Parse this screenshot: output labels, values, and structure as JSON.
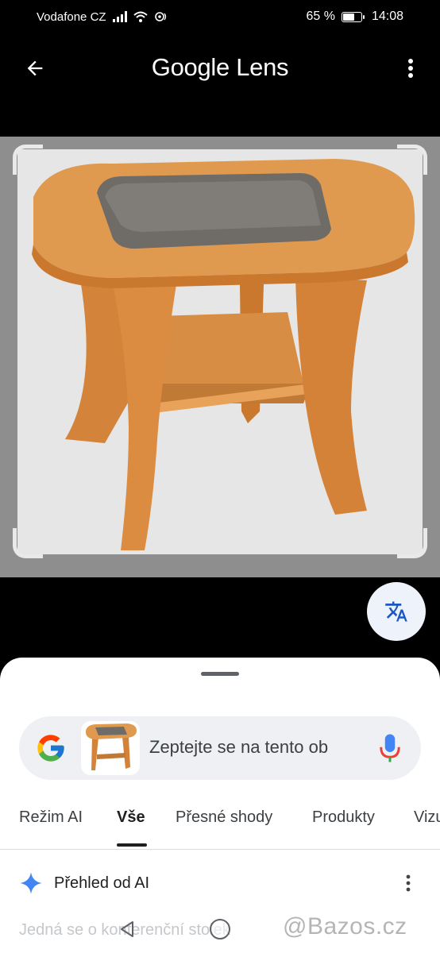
{
  "status_bar": {
    "carrier": "Vodafone CZ",
    "battery_percent": "65 %",
    "battery_level": 0.65,
    "time": "14:08"
  },
  "app_bar": {
    "title": "Google Lens",
    "back_icon": "arrow-back-icon",
    "menu_icon": "more-vert-icon"
  },
  "image": {
    "subject": "wooden coffee table with glass top",
    "translate_icon": "translate-icon"
  },
  "search": {
    "placeholder": "Zeptejte se na tento ob",
    "logo": "google-g-logo",
    "mic_icon": "mic-icon"
  },
  "tabs": [
    {
      "label": "Režim AI",
      "active": false
    },
    {
      "label": "Vše",
      "active": true
    },
    {
      "label": "Přesné shody",
      "active": false
    },
    {
      "label": "Produkty",
      "active": false
    },
    {
      "label": "Vizu",
      "active": false
    }
  ],
  "ai_overview": {
    "title": "Přehled od AI",
    "text": "Jedná se o konferenční stolek"
  },
  "watermark": "@Bazos.cz",
  "colors": {
    "accent_blue": "#4285F4",
    "sheet_bg": "#FFFFFF",
    "search_bg": "#EEF0F4",
    "wood": "#D98A3D"
  }
}
